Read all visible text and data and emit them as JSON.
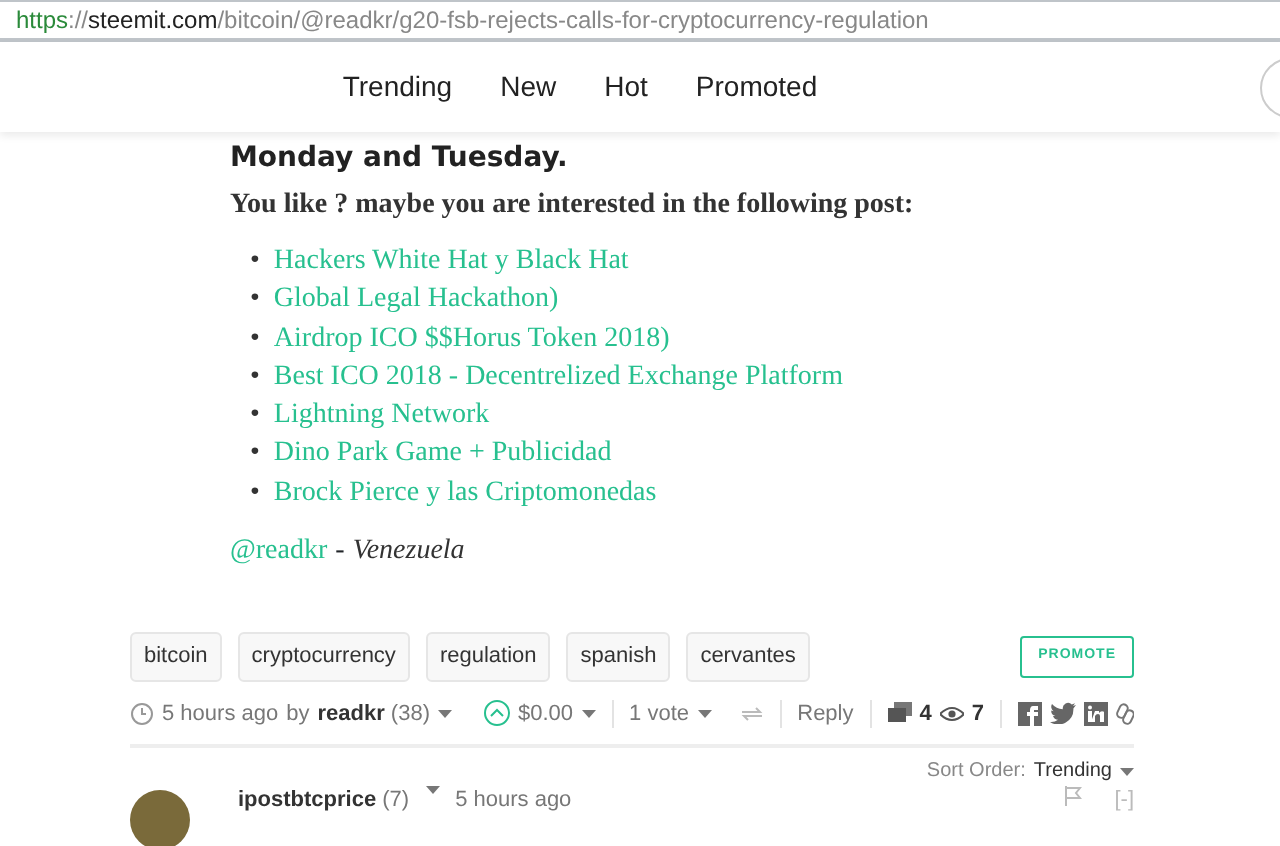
{
  "address_bar": {
    "scheme": "https",
    "separator": "://",
    "domain": "steemit.com",
    "path": "/bitcoin/@readkr/g20-fsb-rejects-calls-for-cryptocurrency-regulation"
  },
  "nav": [
    {
      "label": "Trending"
    },
    {
      "label": "New"
    },
    {
      "label": "Hot"
    },
    {
      "label": "Promoted"
    }
  ],
  "article": {
    "bold_line": "Monday and Tuesday.",
    "intro": "You like ? maybe you are interested in the following post:",
    "marker": "•",
    "links": [
      "Hackers White Hat y Black Hat",
      "Global Legal Hackathon)",
      "Airdrop ICO $$Horus Token 2018)",
      "Best ICO 2018 - Decentrelized Exchange Platform",
      "Lightning Network",
      "Dino Park Game + Publicidad",
      "Brock Pierce y las Criptomonedas"
    ],
    "signature": {
      "handle": "@readkr",
      "separator": "-",
      "place": "Venezuela"
    }
  },
  "tags": [
    "bitcoin",
    "cryptocurrency",
    "regulation",
    "spanish",
    "cervantes"
  ],
  "promote": "PROMOTE",
  "meta": {
    "time": "5 hours ago",
    "by": "by",
    "author": "readkr",
    "reputation": "(38)",
    "payout": "$0.00",
    "votes": "1 vote",
    "reply": "Reply",
    "comments": "4",
    "views": "7"
  },
  "sort": {
    "label": "Sort Order:",
    "value": "Trending"
  },
  "comment": {
    "author": "ipostbtcprice",
    "reputation": "(7)",
    "time": "5 hours ago",
    "collapse": "[-]"
  }
}
